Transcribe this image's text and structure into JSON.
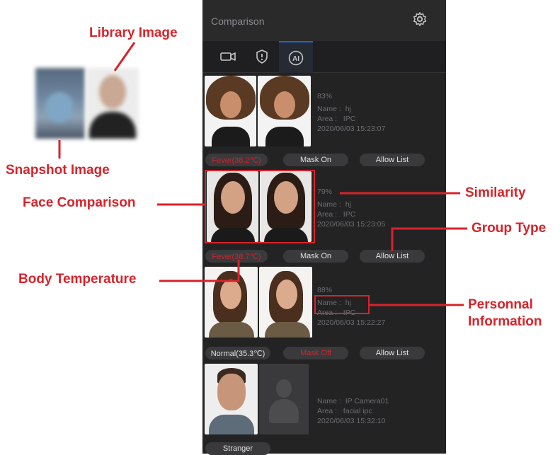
{
  "annotations": {
    "library_image": "Library Image",
    "snapshot_image": "Snapshot Image",
    "face_comparison": "Face Comparison",
    "body_temperature": "Body Temperature",
    "similarity": "Similarity",
    "group_type": "Group Type",
    "personnal_information_line1": "Personnal",
    "personnal_information_line2": "Information"
  },
  "panel": {
    "title": "Comparison",
    "tabs": [
      "camera-icon",
      "shield-icon",
      "ai-icon"
    ],
    "active_tab": "AI",
    "ai_label": "AI"
  },
  "cards": [
    {
      "similarity": "83%",
      "name_label": "Name :",
      "name": "hj",
      "area_label": "Area :",
      "area": "IPC",
      "time": "2020/06/03 15:23:07",
      "temp": "Fever(38.2℃)",
      "mask": "Mask On",
      "group": "Allow List"
    },
    {
      "similarity": "79%",
      "name_label": "Name :",
      "name": "hj",
      "area_label": "Area :",
      "area": "IPC",
      "time": "2020/06/03 15:23:05",
      "temp": "Fever(38.7℃)",
      "mask": "Mask On",
      "group": "Allow List"
    },
    {
      "similarity": "88%",
      "name_label": "Name :",
      "name": "hj",
      "area_label": "Area :",
      "area": "IPC",
      "time": "2020/06/03 15:22:27",
      "temp": "Normal(35.3℃)",
      "mask": "Mask Off",
      "group": "Allow List"
    },
    {
      "similarity": "",
      "name_label": "Name :",
      "name": "IP Camera01",
      "area_label": "Area :",
      "area": "facial ipc",
      "time": "2020/06/03 15:32:10",
      "group": "Stranger"
    }
  ],
  "colors": {
    "annotation": "#d8232a",
    "panel_bg": "#252526",
    "pill_bg": "#3a3a3d",
    "alert": "#c8282c",
    "accent": "#1e64c8"
  }
}
